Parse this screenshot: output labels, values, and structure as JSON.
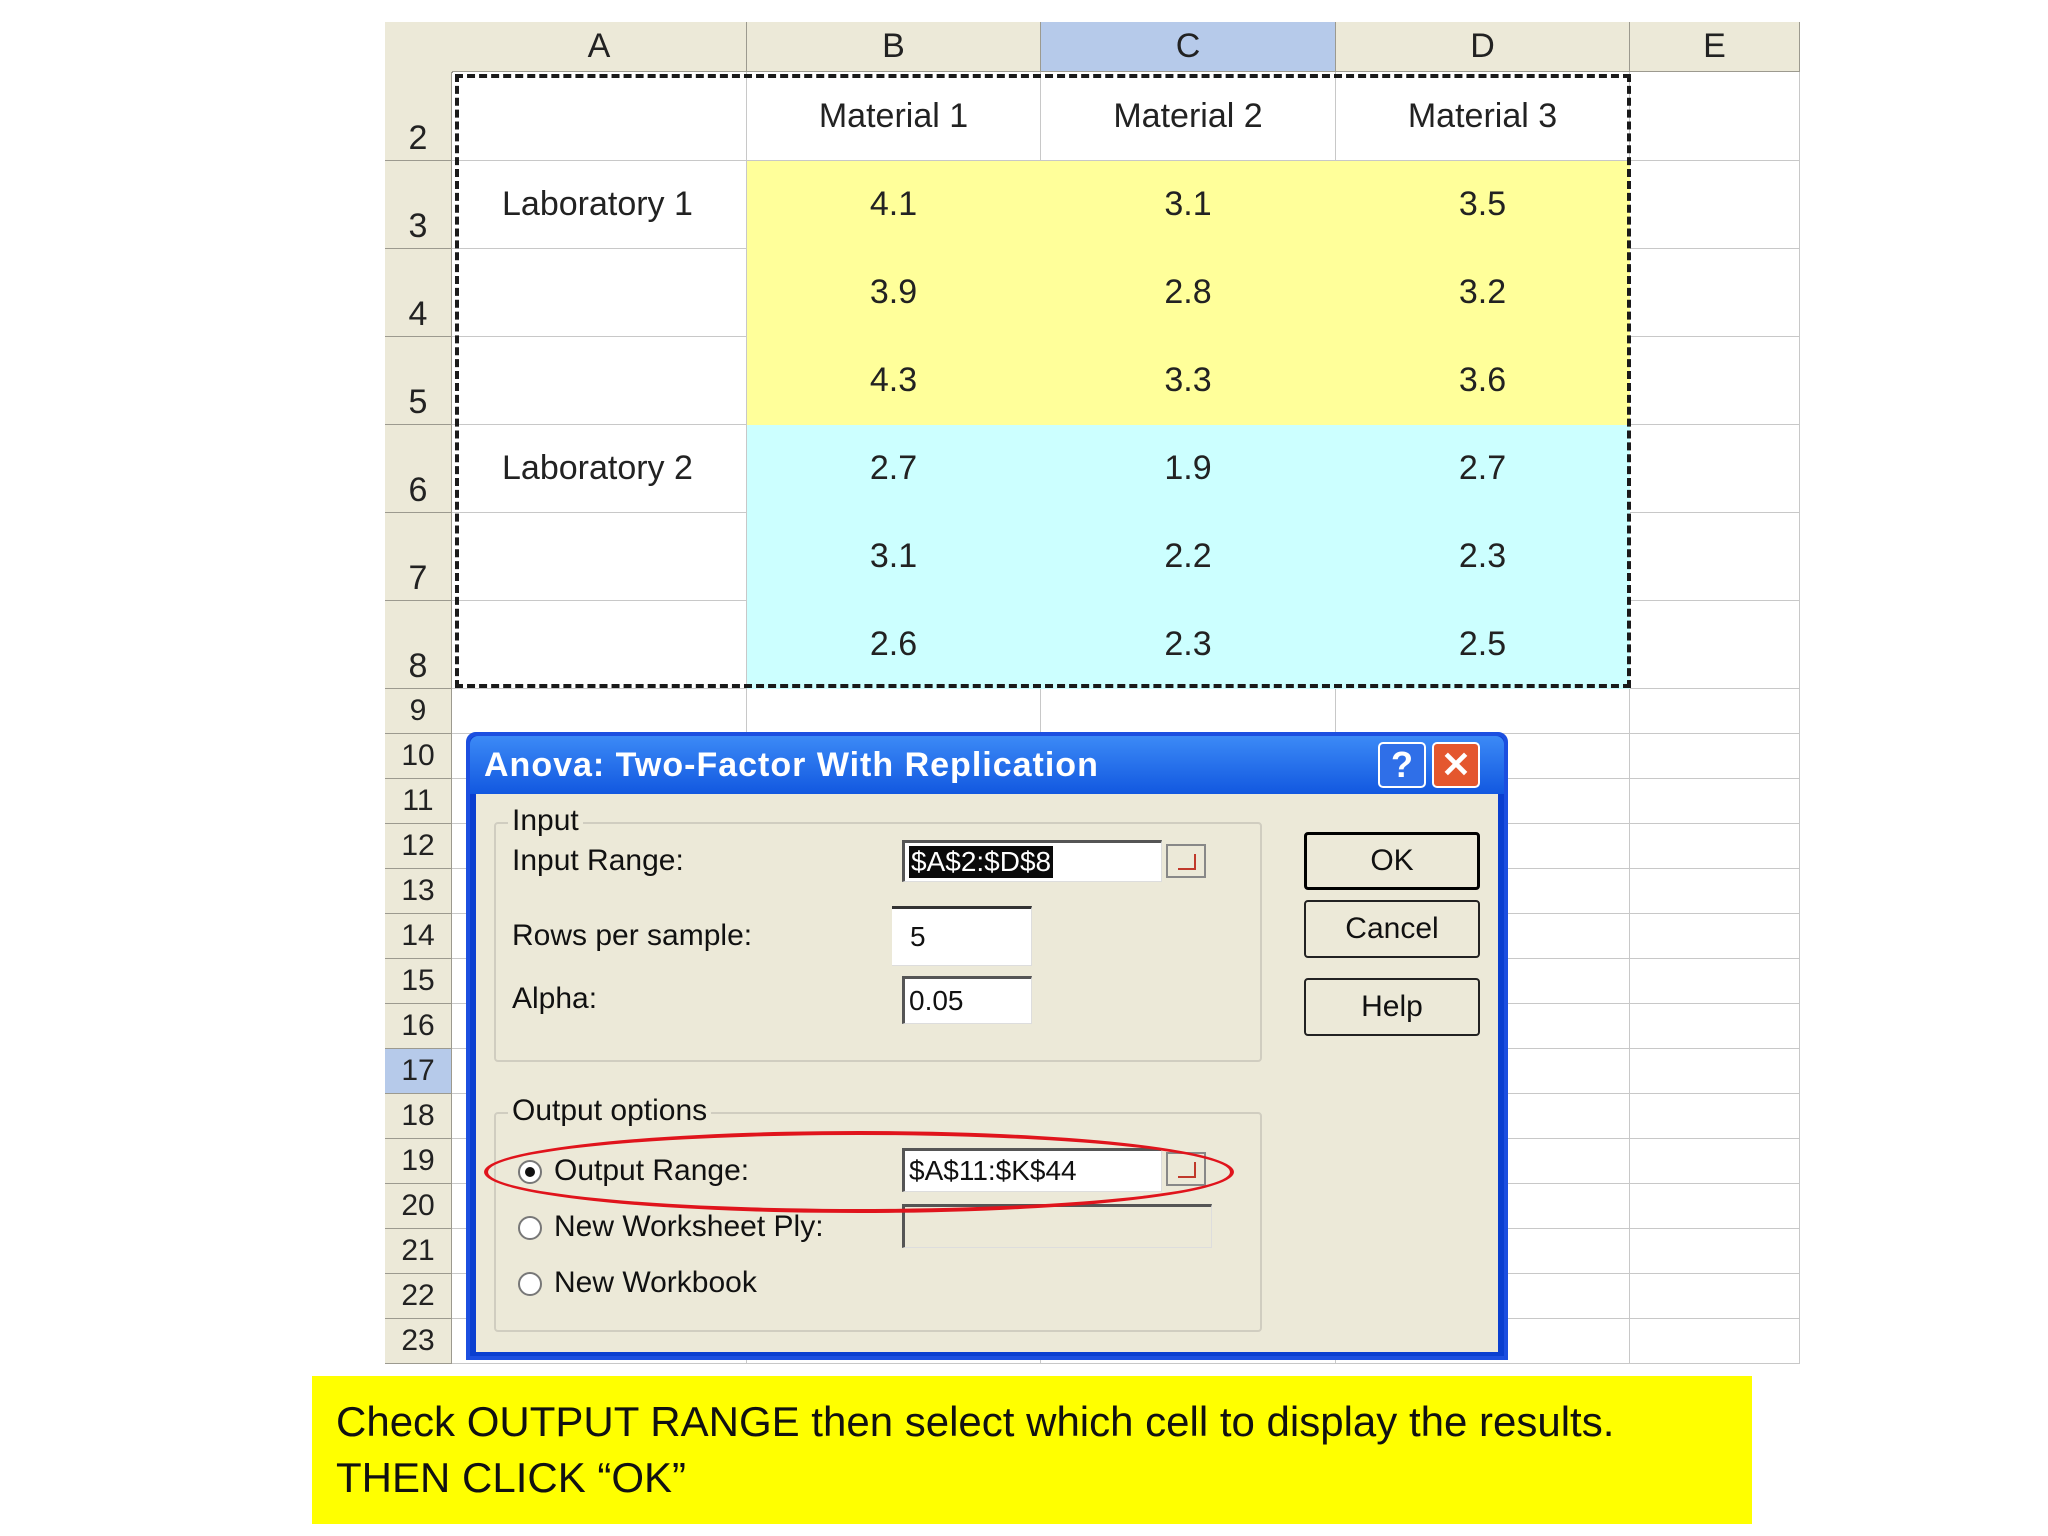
{
  "sheet": {
    "columns": [
      "A",
      "B",
      "C",
      "D",
      "E"
    ],
    "rows": [
      "2",
      "3",
      "4",
      "5",
      "6",
      "7",
      "8",
      "9",
      "10",
      "11",
      "12",
      "13",
      "14",
      "15",
      "16",
      "17",
      "18",
      "19",
      "20",
      "21",
      "22",
      "23"
    ],
    "headers": {
      "b": "Material 1",
      "c": "Material 2",
      "d": "Material 3"
    },
    "labels": {
      "lab1": "Laboratory 1",
      "lab2": "Laboratory 2"
    },
    "data": [
      [
        "4.1",
        "3.1",
        "3.5"
      ],
      [
        "3.9",
        "2.8",
        "3.2"
      ],
      [
        "4.3",
        "3.3",
        "3.6"
      ],
      [
        "2.7",
        "1.9",
        "2.7"
      ],
      [
        "3.1",
        "2.2",
        "2.3"
      ],
      [
        "2.6",
        "2.3",
        "2.5"
      ]
    ],
    "colors": {
      "lab1_fill": "#ffff9a",
      "lab2_fill": "#ccffff",
      "selected_header": "#b6caea"
    }
  },
  "dialog": {
    "title": "Anova: Two-Factor With Replication",
    "help_glyph": "?",
    "close_glyph": "✕",
    "input_group": "Input",
    "input_range_label": "Input Range:",
    "input_range_value": "$A$2:$D$8",
    "rows_per_sample_label": "Rows per sample:",
    "rows_per_sample_value": "5",
    "alpha_label": "Alpha:",
    "alpha_value": "0.05",
    "output_group": "Output options",
    "output_range_label": "Output Range:",
    "output_range_value": "$A$11:$K$44",
    "new_worksheet_label": "New Worksheet Ply:",
    "new_workbook_label": "New Workbook",
    "ok": "OK",
    "cancel": "Cancel",
    "help": "Help",
    "highlight_color": "#e0141c"
  },
  "caption": {
    "line1": "Check OUTPUT RANGE then select which cell to display the results.",
    "line2": "THEN CLICK “OK”"
  }
}
